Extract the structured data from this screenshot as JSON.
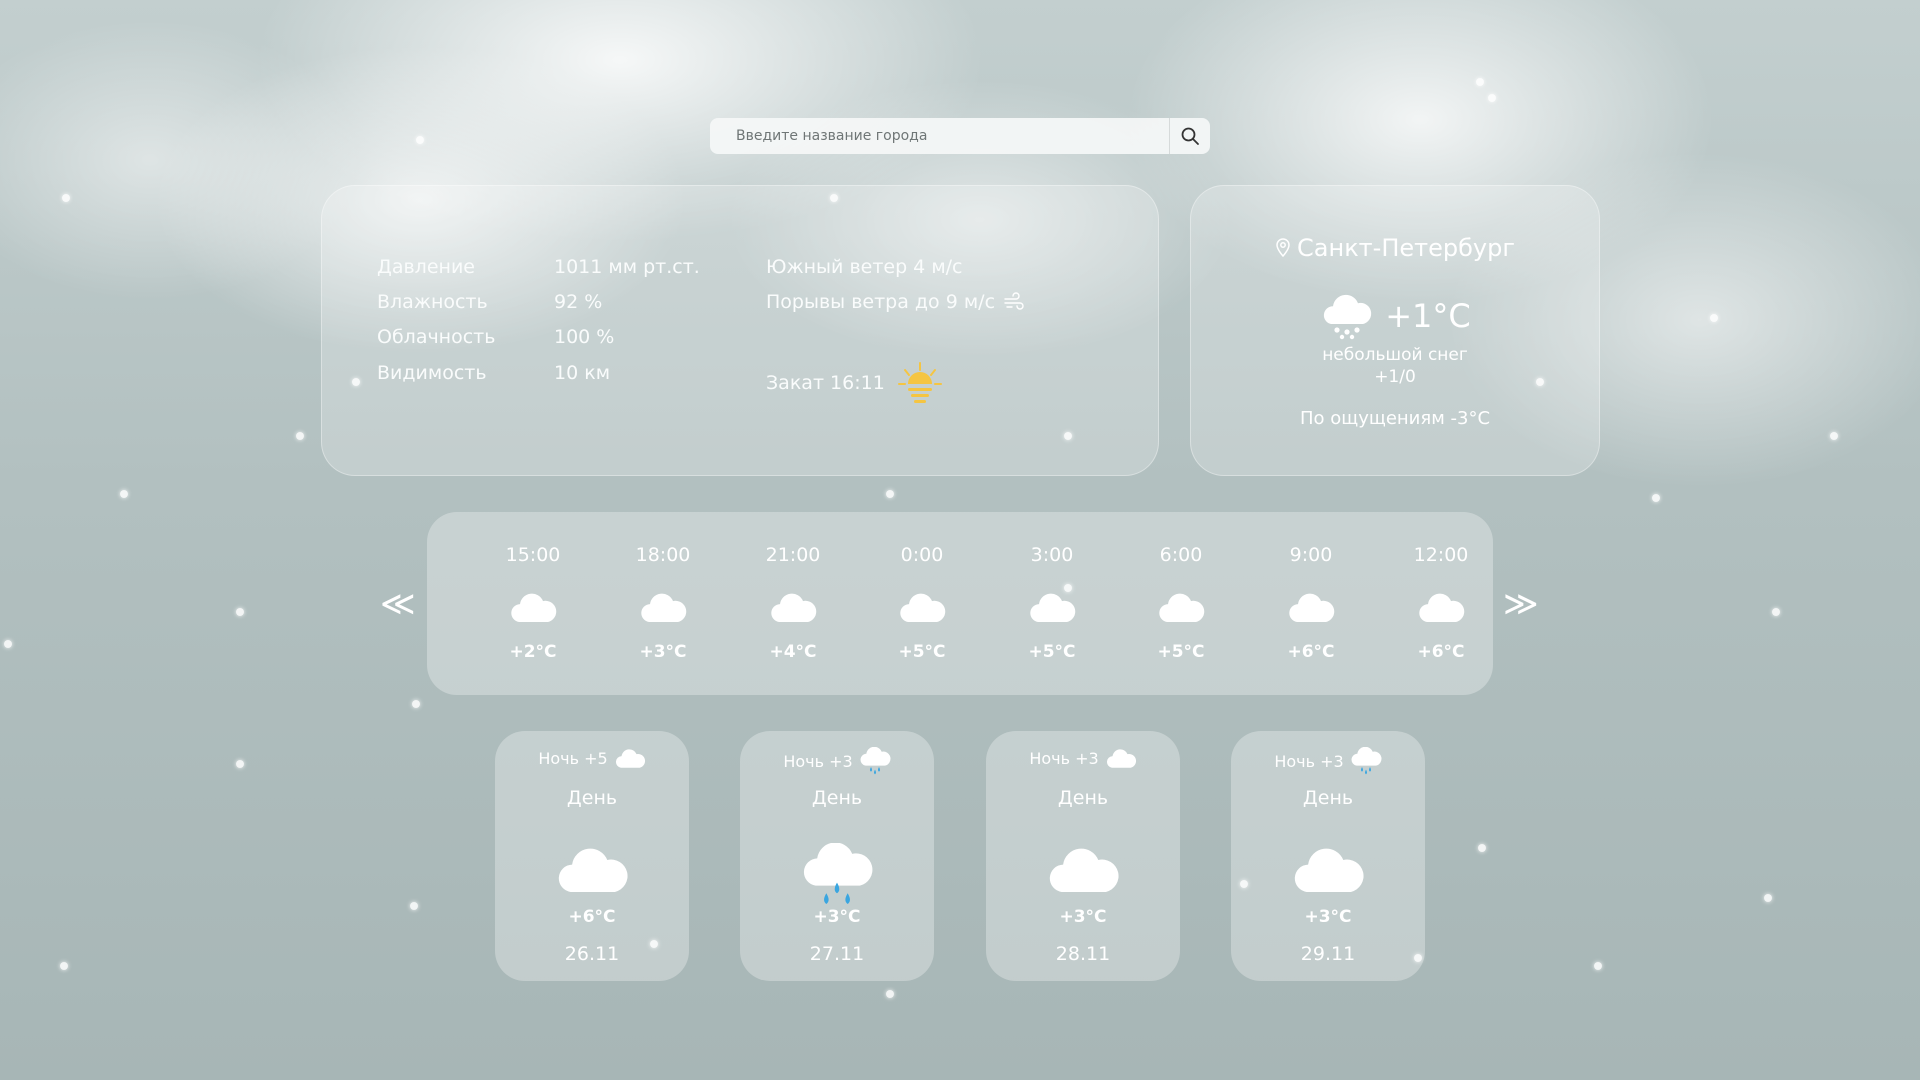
{
  "search": {
    "placeholder": "Введите название города",
    "icon": "search-icon"
  },
  "details": {
    "pressure_label": "Давление",
    "pressure_value": "1011 мм рт.ст.",
    "humidity_label": "Влажность",
    "humidity_value": "92 %",
    "cloudiness_label": "Облачность",
    "cloudiness_value": "100 %",
    "visibility_label": "Видимость",
    "visibility_value": "10 км",
    "wind": "Южный ветер 4 м/с",
    "gusts": "Порывы ветра до 9 м/с",
    "sunset": "Закат 16:11"
  },
  "current": {
    "city": "Санкт-Петербург",
    "temp": "+1°C",
    "description": "небольшой снег",
    "precip": "+1/0",
    "feels_like": "По ощущениям -3°C"
  },
  "hourly": [
    {
      "time": "15:00",
      "temp": "+2°C",
      "icon": "cloud-icon"
    },
    {
      "time": "18:00",
      "temp": "+3°C",
      "icon": "cloud-icon"
    },
    {
      "time": "21:00",
      "temp": "+4°C",
      "icon": "cloud-icon"
    },
    {
      "time": "0:00",
      "temp": "+5°C",
      "icon": "cloud-icon"
    },
    {
      "time": "3:00",
      "temp": "+5°C",
      "icon": "cloud-icon"
    },
    {
      "time": "6:00",
      "temp": "+5°C",
      "icon": "cloud-icon"
    },
    {
      "time": "9:00",
      "temp": "+6°C",
      "icon": "cloud-icon"
    },
    {
      "time": "12:00",
      "temp": "+6°C",
      "icon": "cloud-icon"
    }
  ],
  "nav": {
    "prev": "≪",
    "next": "≫"
  },
  "daily": [
    {
      "night": "Ночь +5",
      "night_icon": "cloud-icon",
      "label": "День",
      "icon": "cloud-icon",
      "temp": "+6°C",
      "date": "26.11"
    },
    {
      "night": "Ночь +3",
      "night_icon": "rain-cloud-icon",
      "label": "День",
      "icon": "rain-cloud-icon",
      "temp": "+3°C",
      "date": "27.11"
    },
    {
      "night": "Ночь +3",
      "night_icon": "cloud-icon",
      "label": "День",
      "icon": "cloud-icon",
      "temp": "+3°C",
      "date": "28.11"
    },
    {
      "night": "Ночь +3",
      "night_icon": "rain-cloud-icon",
      "label": "День",
      "icon": "cloud-icon",
      "temp": "+3°C",
      "date": "29.11"
    }
  ],
  "colors": {
    "background": "#a9b8b8",
    "text": "#ffffff",
    "sun": "#f5c542",
    "rain": "#3aa6e0"
  }
}
